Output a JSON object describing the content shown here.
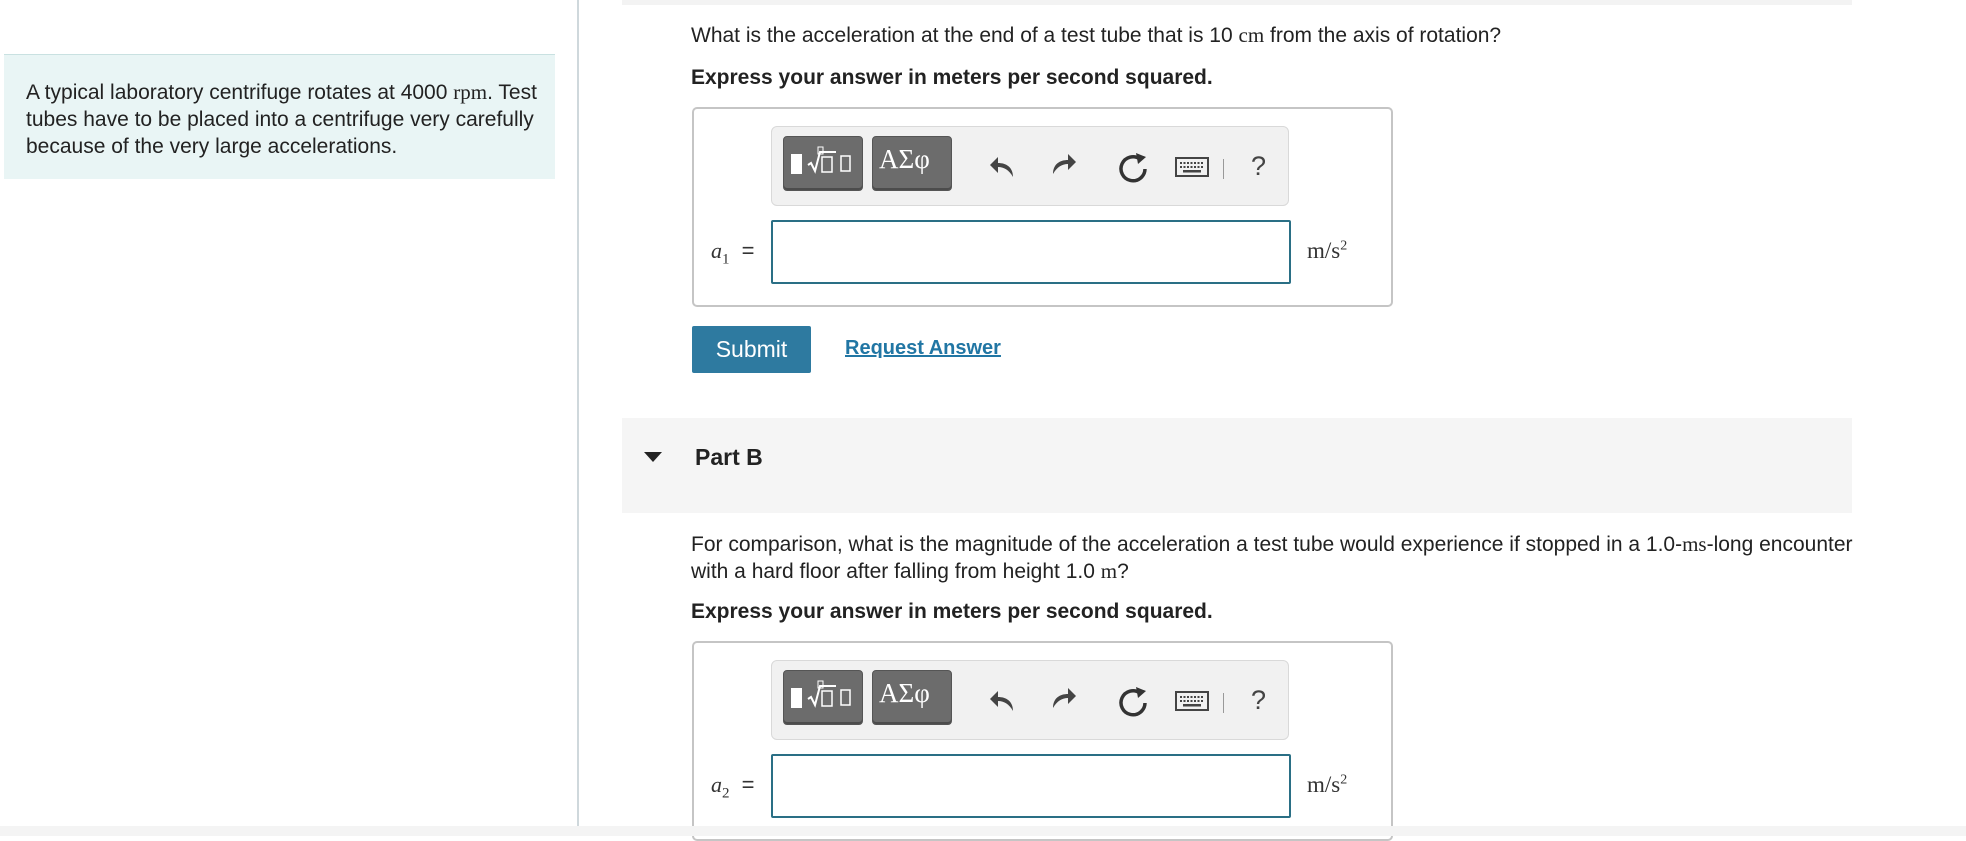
{
  "intro": {
    "line1_pre": "A typical laboratory centrifuge rotates at 4000 ",
    "line1_unit": "rpm",
    "line1_post": ".",
    "line2": "Test tubes have to be placed into a centrifuge very carefully because of the very large accelerations."
  },
  "part_a": {
    "question_pre": "What is the acceleration at the end of a test tube that is 10 ",
    "question_unit": "cm",
    "question_post": " from the axis of rotation?",
    "instruction": "Express your answer in meters per second squared.",
    "variable_base": "a",
    "variable_sub": "1",
    "equals": "=",
    "unit_base": "m/s",
    "unit_exp": "2",
    "submit_label": "Submit",
    "request_label": "Request Answer"
  },
  "part_b": {
    "header": "Part B",
    "question_pre": "For comparison, what is the magnitude of the acceleration a test tube would experience if stopped in a 1.0-",
    "question_unit1": "ms",
    "question_mid": "-long encounter with a hard floor after falling from height 1.0 ",
    "question_unit2": "m",
    "question_post": "?",
    "instruction": "Express your answer in meters per second squared.",
    "variable_base": "a",
    "variable_sub": "2",
    "equals": "=",
    "unit_base": "m/s",
    "unit_exp": "2"
  },
  "toolbar": {
    "templates_icon": "templates-icon",
    "symbols_label": "ΑΣφ",
    "undo_icon": "undo-icon",
    "redo_icon": "redo-icon",
    "reset_icon": "reset-icon",
    "keyboard_icon": "keyboard-icon",
    "help_label": "?"
  },
  "colors": {
    "intro_bg": "#e9f5f5",
    "submit_bg": "#2e7aa0",
    "link": "#2176a4",
    "input_border": "#2a6f85",
    "toolbar_button": "#6c6c6c"
  }
}
